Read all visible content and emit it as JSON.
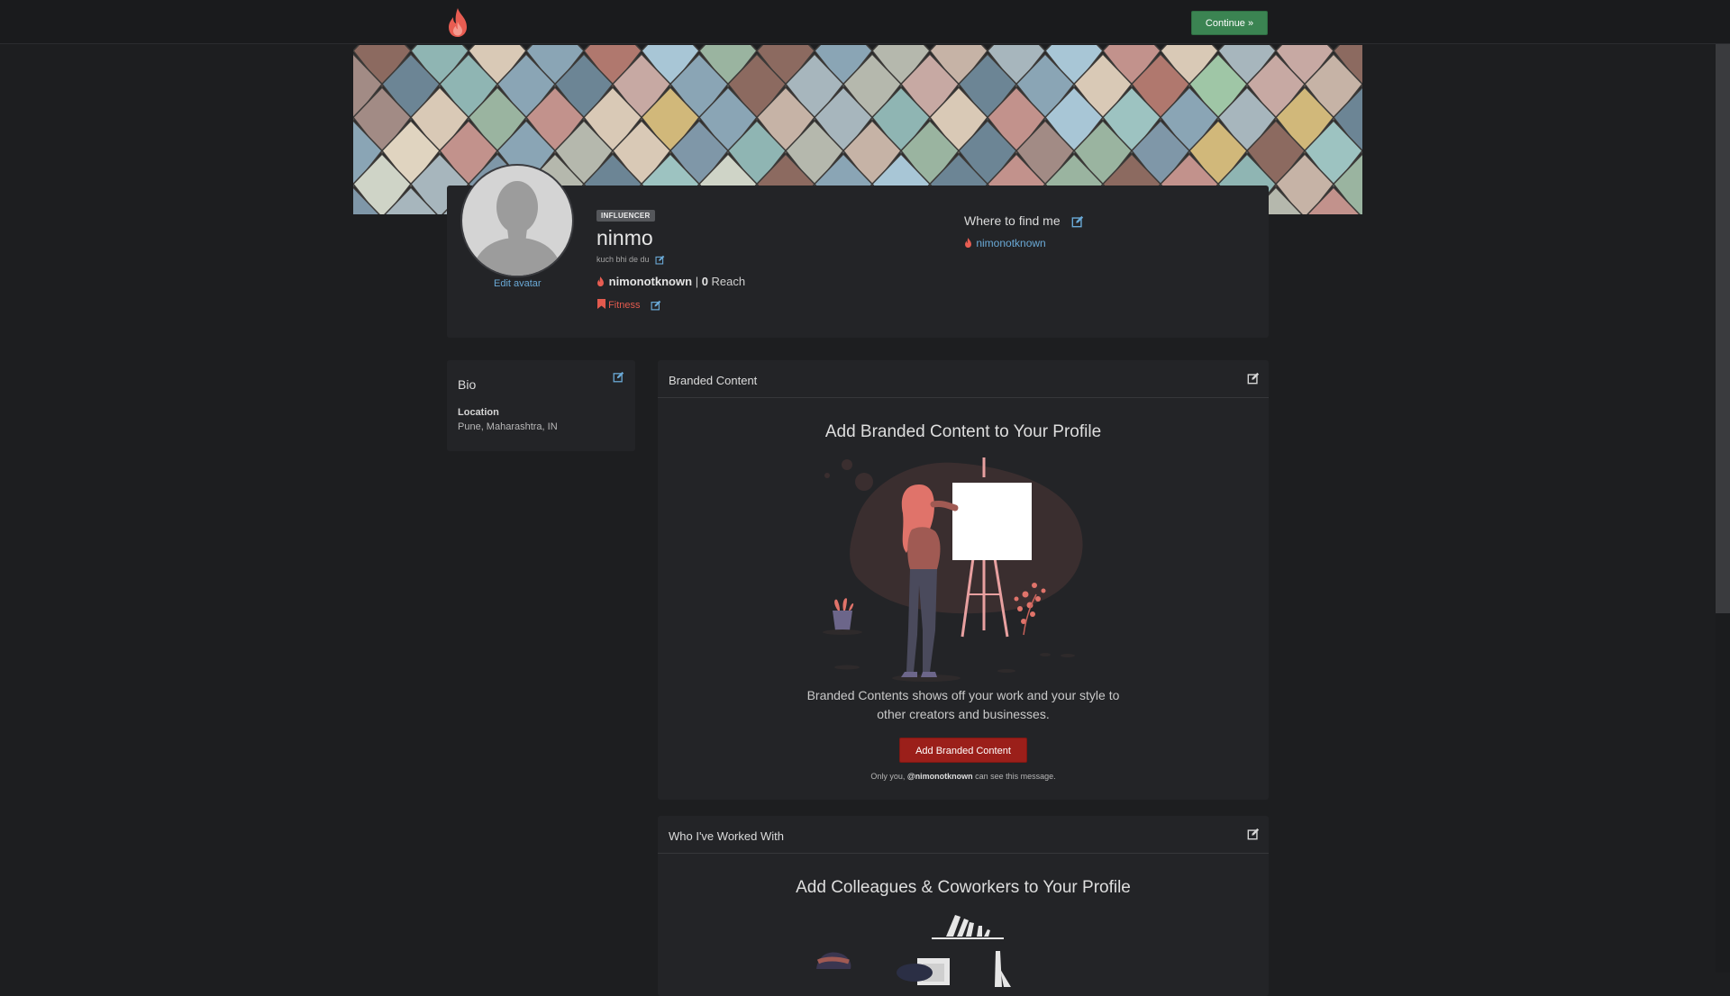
{
  "topbar": {
    "continue_label": "Continue »"
  },
  "profile": {
    "edit_avatar_label": "Edit avatar",
    "badge": "INFLUENCER",
    "name": "ninmo",
    "tagline": "kuch bhi de du",
    "handle": "nimonotknown",
    "reach_count": "0",
    "reach_label": "Reach",
    "category": "Fitness"
  },
  "find_me": {
    "title": "Where to find me",
    "link": "nimonotknown"
  },
  "bio": {
    "title": "Bio",
    "location_label": "Location",
    "location_value": "Pune, Maharashtra, IN"
  },
  "branded": {
    "header": "Branded Content",
    "heading": "Add Branded Content to Your Profile",
    "description": "Branded Contents shows off your work and your style to other creators and businesses.",
    "button": "Add Branded Content",
    "note_prefix": "Only you, ",
    "note_handle": "@nimonotknown",
    "note_suffix": " can see this message."
  },
  "worked": {
    "header": "Who I've Worked With",
    "heading": "Add Colleagues & Coworkers to Your Profile"
  },
  "colors": {
    "accent_red": "#9b1f1a",
    "accent_green": "#3b8452",
    "link_blue": "#6aa9d6",
    "brand_flame": "#e85d52"
  },
  "icons": [
    "flame-icon",
    "edit-icon",
    "bookmark-icon",
    "avatar-placeholder-icon"
  ]
}
